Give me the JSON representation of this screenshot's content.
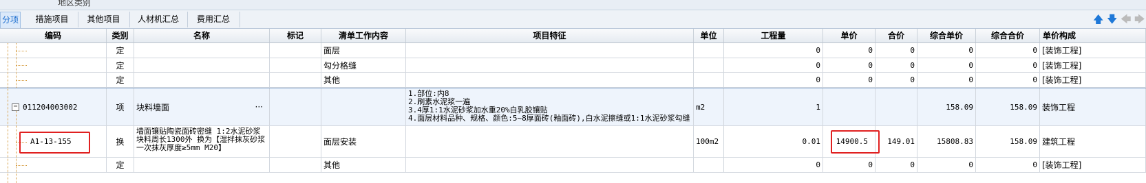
{
  "top_label": "地区类别",
  "tabs": [
    {
      "label": "分项",
      "active": true
    },
    {
      "label": "措施项目",
      "active": false
    },
    {
      "label": "其他项目",
      "active": false
    },
    {
      "label": "人材机汇总",
      "active": false
    },
    {
      "label": "费用汇总",
      "active": false
    }
  ],
  "toolbar": {
    "up_icon": "arrow-up-icon",
    "down_icon": "arrow-down-icon",
    "left_icon": "arrow-left-icon",
    "right_icon": "arrow-right-icon"
  },
  "columns": [
    "编码",
    "类别",
    "名称",
    "标记",
    "清单工作内容",
    "项目特征",
    "单位",
    "工程量",
    "单价",
    "合价",
    "综合单价",
    "综合合价",
    "单价构成"
  ],
  "rows": [
    {
      "code": "",
      "type": "定",
      "name": "",
      "mark": "",
      "content": "面层",
      "feature": "",
      "unit": "",
      "qty": "0",
      "price": "0",
      "total": "0",
      "comp_price": "0",
      "comp_total": "0",
      "struct": "[装饰工程]"
    },
    {
      "code": "",
      "type": "定",
      "name": "",
      "mark": "",
      "content": "勾分格缝",
      "feature": "",
      "unit": "",
      "qty": "0",
      "price": "0",
      "total": "0",
      "comp_price": "0",
      "comp_total": "0",
      "struct": "[装饰工程]"
    },
    {
      "code": "",
      "type": "定",
      "name": "",
      "mark": "",
      "content": "其他",
      "feature": "",
      "unit": "",
      "qty": "0",
      "price": "0",
      "total": "0",
      "comp_price": "0",
      "comp_total": "0",
      "struct": "[装饰工程]"
    },
    {
      "code": "011204003002",
      "type": "项",
      "name": "块料墙面",
      "name_more": "···",
      "mark": "",
      "content": "",
      "feature_lines": [
        "1.部位:内8",
        "2.刷素水泥浆一遍",
        "3.4厚1:1水泥砂浆加水重20%白乳胶镶贴",
        "4.面层材料品种、规格、颜色:5~8厚面砖(釉面砖),白水泥擦缝或1:1水泥砂浆勾缝"
      ],
      "unit": "m2",
      "qty": "1",
      "price": "",
      "total": "",
      "comp_price": "158.09",
      "comp_total": "158.09",
      "struct": "装饰工程"
    },
    {
      "code": "A1-13-155",
      "type": "换",
      "name_lines": [
        "墙面镶贴陶瓷面砖密缝 1:2水泥砂浆",
        "块料周长1300外  换为【湿拌抹灰砂浆",
        "一次抹灰厚度≥5mm M20】"
      ],
      "mark": "",
      "content": "面层安装",
      "feature": "",
      "unit": "100m2",
      "qty": "0.01",
      "price": "14900.5",
      "total": "149.01",
      "comp_price": "15808.83",
      "comp_total": "158.09",
      "struct": "建筑工程"
    },
    {
      "code": "",
      "type": "定",
      "name": "",
      "mark": "",
      "content": "其他",
      "feature": "",
      "unit": "",
      "qty": "0",
      "price": "0",
      "total": "0",
      "comp_price": "0",
      "comp_total": "0",
      "struct": "[装饰工程]"
    }
  ]
}
